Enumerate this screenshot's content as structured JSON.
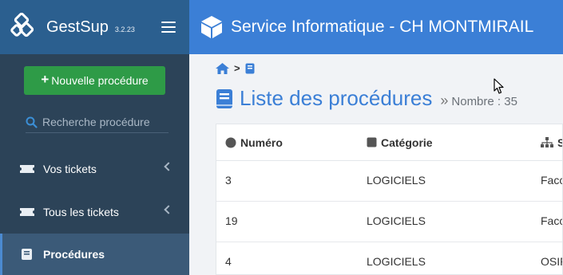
{
  "brand": {
    "name": "GestSup",
    "version": "3.2.23"
  },
  "header": {
    "title": "Service Informatique - CH MONTMIRAIL"
  },
  "sidebar": {
    "new_button": "Nouvelle procédure",
    "search_placeholder": "Recherche procédure",
    "items": [
      {
        "label": "Vos tickets"
      },
      {
        "label": "Tous les tickets"
      },
      {
        "label": "Procédures"
      }
    ]
  },
  "main": {
    "title": "Liste des procédures",
    "count_label": "Nombre : 35",
    "table": {
      "columns": [
        "Numéro",
        "Catégorie",
        "S"
      ],
      "rows": [
        [
          "3",
          "LOGICIELS",
          "Facc"
        ],
        [
          "19",
          "LOGICIELS",
          "Facc"
        ],
        [
          "4",
          "LOGICIELS",
          "OSIF"
        ]
      ]
    }
  },
  "colors": {
    "topbar": "#3b7fd6",
    "brand_bar": "#2b5f8f",
    "sidebar": "#2c4358",
    "new_button": "#2e9b47",
    "accent": "#3b7fd6"
  }
}
